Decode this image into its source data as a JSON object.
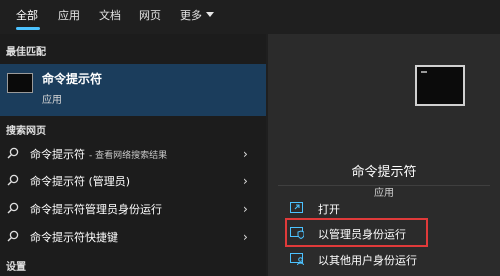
{
  "tabs": {
    "items": [
      "全部",
      "应用",
      "文档",
      "网页",
      "更多"
    ]
  },
  "sections": {
    "best_match": "最佳匹配",
    "search_web": "搜索网页",
    "settings": "设置"
  },
  "best_match": {
    "title": "命令提示符",
    "subtitle": "应用"
  },
  "web_results": [
    {
      "label": "命令提示符",
      "suffix": "- 查看网络搜索结果"
    },
    {
      "label": "命令提示符 (管理员)",
      "suffix": ""
    },
    {
      "label": "命令提示符管理员身份运行",
      "suffix": ""
    },
    {
      "label": "命令提示符快捷键",
      "suffix": ""
    }
  ],
  "detail": {
    "title": "命令提示符",
    "subtitle": "应用",
    "actions": [
      "打开",
      "以管理员身份运行",
      "以其他用户身份运行"
    ]
  },
  "colors": {
    "accent": "#4cc2ff",
    "selected_row": "#1b3d5c",
    "highlight_border": "#e03a3a"
  }
}
